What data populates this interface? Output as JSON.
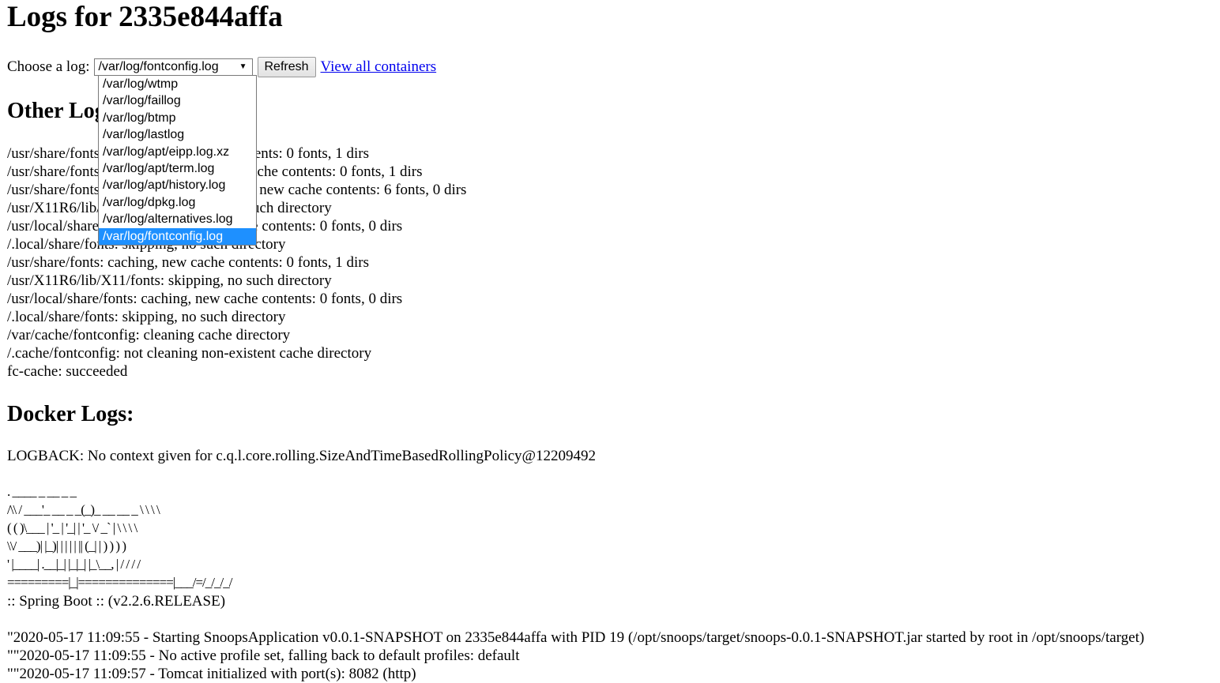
{
  "header": {
    "title": "Logs for 2335e844affa"
  },
  "chooser": {
    "label": "Choose a log:",
    "selected_value": "/var/log/fontconfig.log",
    "arrow": "▼",
    "refresh_label": "Refresh",
    "view_all_label": "View all containers"
  },
  "dropdown": {
    "options": [
      "/var/log/wtmp",
      "/var/log/faillog",
      "/var/log/btmp",
      "/var/log/lastlog",
      "/var/log/apt/eipp.log.xz",
      "/var/log/apt/term.log",
      "/var/log/apt/history.log",
      "/var/log/dpkg.log",
      "/var/log/alternatives.log",
      "/var/log/fontconfig.log"
    ],
    "selected_index": 9,
    "highlight_color": "#1e90ff"
  },
  "other_logs": {
    "heading": "Other Logs:",
    "lines": [
      "/usr/share/fonts: caching, new cache contents: 0 fonts, 1 dirs",
      "/usr/share/fonts/truetype: caching, new cache contents: 0 fonts, 1 dirs",
      "/usr/share/fonts/truetype/dejavu: caching, new cache contents: 6 fonts, 0 dirs",
      "/usr/X11R6/lib/X11/fonts: skipping, no such directory",
      "/usr/local/share/fonts: caching, new cache contents: 0 fonts, 0 dirs",
      "/.local/share/fonts: skipping, no such directory",
      "/usr/share/fonts: caching, new cache contents: 0 fonts, 1 dirs",
      "/usr/X11R6/lib/X11/fonts: skipping, no such directory",
      "/usr/local/share/fonts: caching, new cache contents: 0 fonts, 0 dirs",
      "/.local/share/fonts: skipping, no such directory",
      "/var/cache/fontconfig: cleaning cache directory",
      "/.cache/fontconfig: not cleaning non-existent cache directory",
      "fc-cache: succeeded"
    ]
  },
  "docker_logs": {
    "heading": "Docker Logs:",
    "logback_line": "LOGBACK: No context given for c.q.l.core.rolling.SizeAndTimeBasedRollingPolicy@12209492",
    "banner": [
      ". ____ _ __ _ _",
      "/\\\\ / ___'_ __ _ _(_)_ __ __ _ \\ \\ \\ \\",
      "( ( )\\___ | '_ | '_| | '_ \\/ _` | \\ \\ \\ \\",
      "\\\\/ ___)| |_)| | | | | || (_| | ) ) ) )",
      "' |____| .__|_| |_|_| |_\\__, | / / / /",
      "=========|_|==============|___/=/_/_/_/"
    ],
    "spring_line": ":: Spring Boot :: (v2.2.6.RELEASE)",
    "entries": [
      "\"2020-05-17 11:09:55 - Starting SnoopsApplication v0.0.1-SNAPSHOT on 2335e844affa with PID 19 (/opt/snoops/target/snoops-0.0.1-SNAPSHOT.jar started by root in /opt/snoops/target)",
      "\"\"2020-05-17 11:09:55 - No active profile set, falling back to default profiles: default",
      "\"\"2020-05-17 11:09:57 - Tomcat initialized with port(s): 8082 (http)"
    ]
  }
}
